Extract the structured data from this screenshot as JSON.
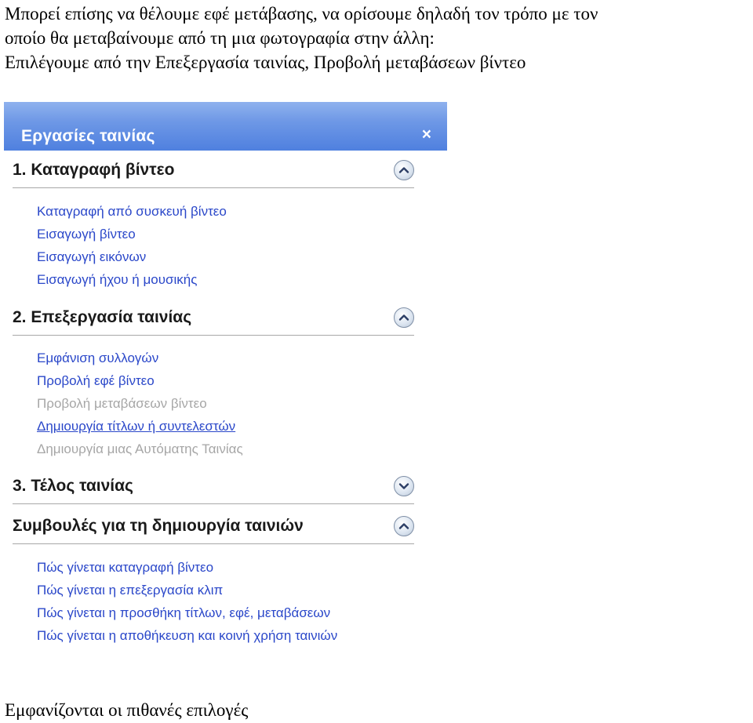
{
  "intro": {
    "lines": [
      "Μπορεί επίσης να θέλουμε εφέ μετάβασης, να ορίσουμε δηλαδή τον τρόπο με τον",
      "οποίο θα μεταβαίνουμε από τη μια φωτογραφία στην άλλη:",
      "Επιλέγουμε από την Επεξεργασία ταινίας, Προβολή μεταβάσεων βίντεο"
    ]
  },
  "pane": {
    "title": "Εργασίες ταινίας",
    "close_glyph": "×",
    "header_color": "#5a88e2",
    "sections": [
      {
        "title": "1. Καταγραφή βίντεο",
        "state": "expanded",
        "links": [
          {
            "label": "Καταγραφή από συσκευή βίντεο",
            "enabled": true
          },
          {
            "label": "Εισαγωγή βίντεο",
            "enabled": true
          },
          {
            "label": "Εισαγωγή εικόνων",
            "enabled": true
          },
          {
            "label": "Εισαγωγή ήχου ή μουσικής",
            "enabled": true
          }
        ]
      },
      {
        "title": "2. Επεξεργασία ταινίας",
        "state": "expanded",
        "links": [
          {
            "label": "Εμφάνιση συλλογών",
            "enabled": true
          },
          {
            "label": "Προβολή εφέ βίντεο",
            "enabled": true
          },
          {
            "label": "Προβολή μεταβάσεων βίντεο",
            "enabled": false
          },
          {
            "label": "Δημιουργία τίτλων ή συντελεστών",
            "enabled": true
          },
          {
            "label": "Δημιουργία μιας Αυτόματης Ταινίας",
            "enabled": false
          }
        ]
      },
      {
        "title": "3. Τέλος ταινίας",
        "state": "collapsed",
        "links": []
      },
      {
        "title": "Συμβουλές για τη δημιουργία ταινιών",
        "state": "expanded",
        "links": [
          {
            "label": "Πώς γίνεται καταγραφή βίντεο",
            "enabled": true
          },
          {
            "label": "Πώς γίνεται η επεξεργασία κλιπ",
            "enabled": true
          },
          {
            "label": "Πώς γίνεται η προσθήκη τίτλων, εφέ, μεταβάσεων",
            "enabled": true
          },
          {
            "label": "Πώς γίνεται η αποθήκευση και κοινή χρήση ταινιών",
            "enabled": true
          }
        ]
      }
    ],
    "link_color": "#2a47c9",
    "disabled_link_color": "#a6a6a6"
  },
  "caption": "Εμφανίζονται οι πιθανές επιλογές"
}
